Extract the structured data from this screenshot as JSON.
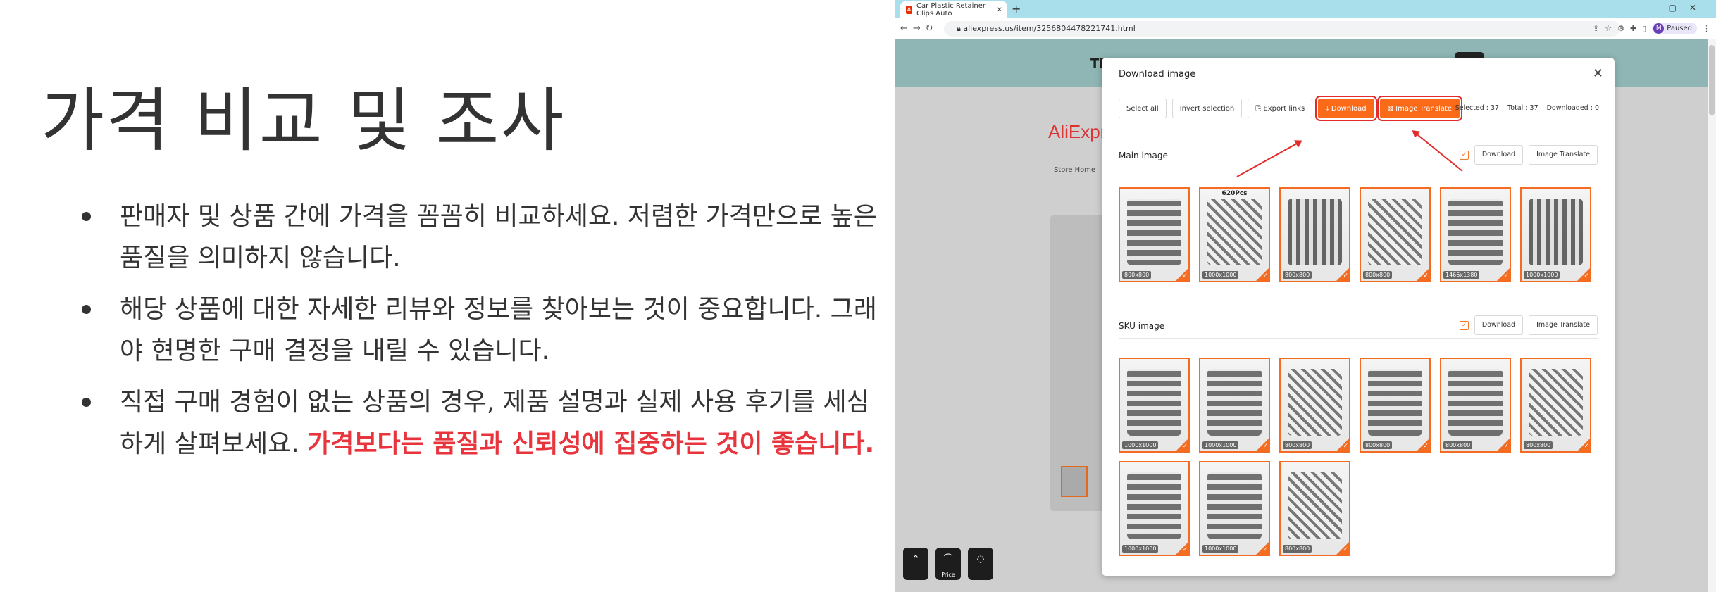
{
  "slide": {
    "title": "가격 비교 및 조사",
    "bullets": [
      {
        "text": "판매자 및 상품 간에 가격을 꼼꼼히 비교하세요. 저렴한 가격만으로 높은 품질을 의미하지 않습니다.",
        "highlight": ""
      },
      {
        "text": "해당 상품에 대한 자세한 리뷰와 정보를 찾아보는 것이 중요합니다. 그래야 현명한 구매 결정을 내릴 수 있습니다.",
        "highlight": ""
      },
      {
        "text": "직접 구매 경험이 없는 상품의 경우, 제품 설명과 실제 사용 후기를 세심하게 살펴보세요. ",
        "highlight": "가격보다는 품질과 신뢰성에 집중하는 것이 좋습니다."
      }
    ],
    "highlight_color": "#e8343c"
  },
  "browser": {
    "tab_title": "Car Plastic Retainer Clips Auto",
    "url": "aliexpress.us/item/3256804478221741.html",
    "profile_initial": "M",
    "profile_status": "Paused",
    "banner_text": "TRI",
    "logo": "AliExpre",
    "store_home": "Store Home",
    "float_price": "Price"
  },
  "modal": {
    "title": "Download image",
    "toolbar": {
      "select_all": "Select all",
      "invert_selection": "Invert selection",
      "export_links": "Export links",
      "download": "Download",
      "image_translate": "Image Translate"
    },
    "stats": {
      "selected": "Selected : 37",
      "total": "Total : 37",
      "downloaded": "Downloaded : 0"
    },
    "main_section": {
      "title": "Main image",
      "download": "Download",
      "image_translate": "Image Translate",
      "images": [
        {
          "dims": "800x800",
          "label": ""
        },
        {
          "dims": "1000x1000",
          "label": "620Pcs"
        },
        {
          "dims": "800x800",
          "label": ""
        },
        {
          "dims": "800x800",
          "label": ""
        },
        {
          "dims": "1466x1380",
          "label": ""
        },
        {
          "dims": "1000x1000",
          "label": ""
        }
      ]
    },
    "sku_section": {
      "title": "SKU image",
      "download": "Download",
      "image_translate": "Image Translate",
      "images": [
        {
          "dims": "1000x1000"
        },
        {
          "dims": "1000x1000"
        },
        {
          "dims": "800x800"
        },
        {
          "dims": "800x800"
        },
        {
          "dims": "800x800"
        },
        {
          "dims": "800x800"
        },
        {
          "dims": "1000x1000"
        },
        {
          "dims": "1000x1000"
        },
        {
          "dims": "800x800"
        }
      ]
    },
    "accent_color": "#fa6a18",
    "annotation_color": "#e32b2b"
  }
}
